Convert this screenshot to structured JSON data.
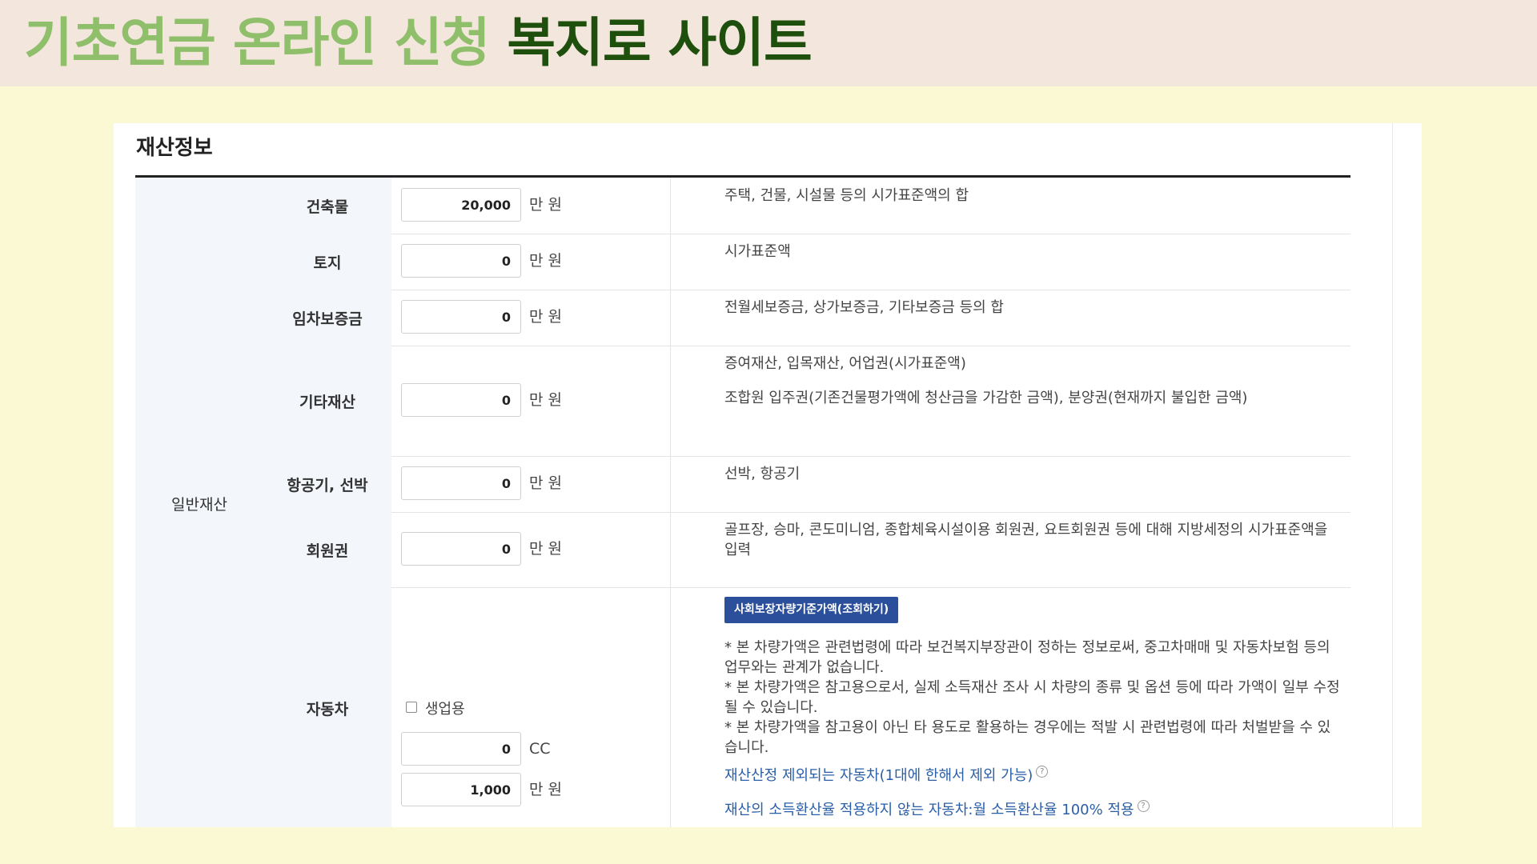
{
  "banner": {
    "title_part1": "기초연금 온라인 신청",
    "title_part2": "복지로 사이트",
    "colors": {
      "light": "#8fbf6a",
      "dark": "#1f4f0d",
      "background": "#f3e6dc"
    }
  },
  "section": {
    "title": "재산정보"
  },
  "category": "일반재산",
  "rows": [
    {
      "label": "건축물",
      "value": "20,000",
      "unit": "만 원",
      "desc": [
        "주택, 건물, 시설물 등의 시가표준액의 합"
      ]
    },
    {
      "label": "토지",
      "value": "0",
      "unit": "만 원",
      "desc": [
        "시가표준액"
      ]
    },
    {
      "label": "임차보증금",
      "value": "0",
      "unit": "만 원",
      "desc": [
        "전월세보증금, 상가보증금, 기타보증금 등의 합"
      ]
    },
    {
      "label": "기타재산",
      "value": "0",
      "unit": "만 원",
      "desc": [
        "증여재산, 입목재산, 어업권(시가표준액)",
        "조합원 입주권(기존건물평가액에 청산금을 가감한 금액), 분양권(현재까지 불입한 금액)"
      ]
    },
    {
      "label": "항공기, 선박",
      "value": "0",
      "unit": "만 원",
      "desc": [
        "선박, 항공기"
      ]
    },
    {
      "label": "회원권",
      "value": "0",
      "unit": "만 원",
      "desc": [
        "골프장, 승마, 콘도미니엄, 종합체육시설이용 회원권, 요트회원권 등에 대해 지방세정의 시가표준액을 입력"
      ]
    }
  ],
  "car": {
    "label": "자동차",
    "checkbox_label": "생업용",
    "cc_value": "0",
    "cc_unit": "CC",
    "price_value": "1,000",
    "price_unit": "만 원",
    "lookup_button": "사회보장자량기준가액(조회하기)",
    "notes": [
      "* 본 차량가액은 관련법령에 따라 보건복지부장관이 정하는 정보로써, 중고차매매 및 자동차보험 등의 업무와는 관계가 없습니다.",
      "* 본 차량가액은 참고용으로서, 실제 소득재산 조사 시 차량의 종류 및 옵션 등에 따라 가액이 일부 수정될 수 있습니다.",
      "* 본 차량가액을 참고용이 아닌 타 용도로 활용하는 경우에는 적발 시 관련법령에 따라 처벌받을 수 있습니다."
    ],
    "link1": "재산산정 제외되는 자동차(1대에 한해서 제외 가능)",
    "link2": "재산의 소득환산율 적용하지 않는 자동차:월 소득환산율 100% 적용",
    "help_glyph": "?"
  },
  "accent_color": "#2b4f9a"
}
